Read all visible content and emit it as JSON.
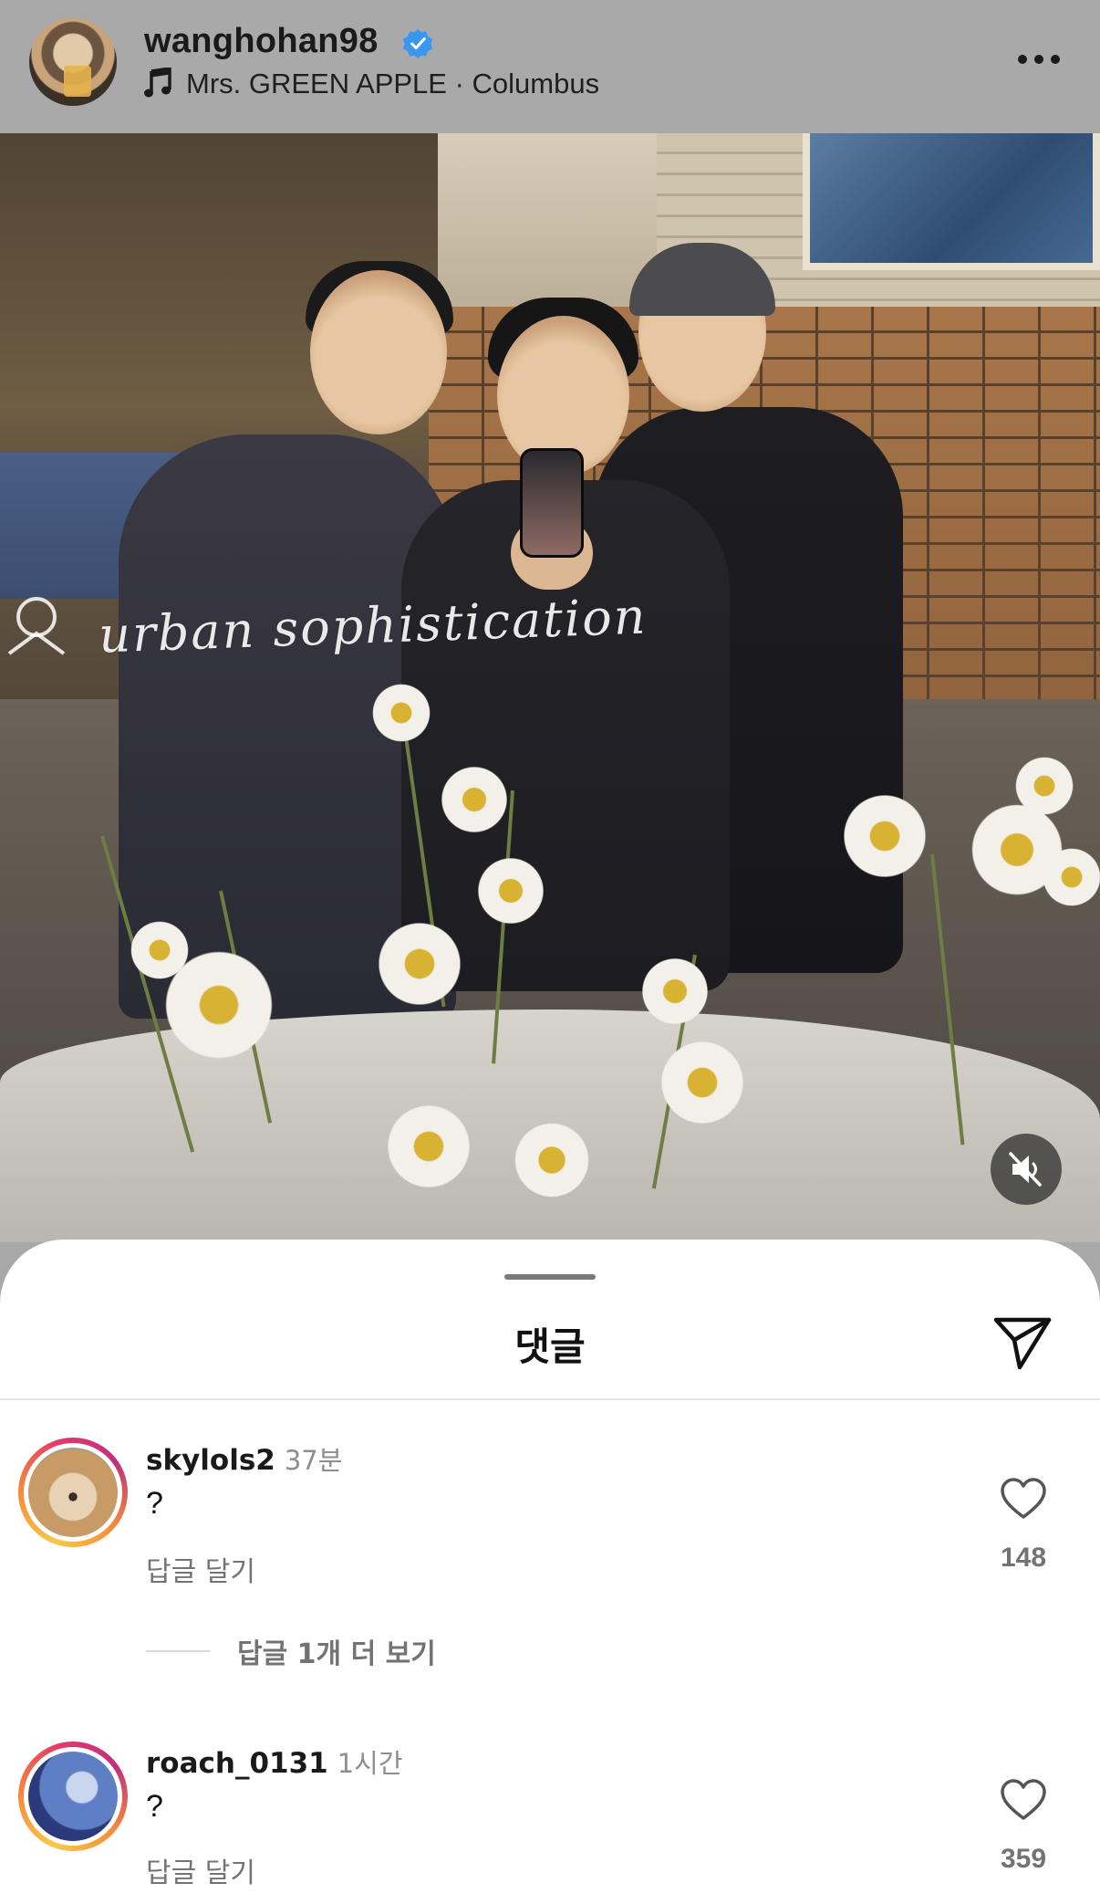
{
  "header": {
    "username": "wanghohan98",
    "verified_icon": "verified-badge-icon",
    "music": "Mrs. GREEN APPLE · Columbus",
    "more_icon": "more-horizontal-icon"
  },
  "video": {
    "watermark": "urban sophistication",
    "mute_icon": "speaker-muted-icon"
  },
  "comments_sheet": {
    "title": "댓글",
    "share_icon": "send-icon",
    "comments": [
      {
        "username": "skylols2",
        "time": "37분",
        "text": "?",
        "reply_label": "답글 달기",
        "likes": "148",
        "view_more": "답글 1개 더 보기"
      },
      {
        "username": "roach_0131",
        "time": "1시간",
        "text": "?",
        "reply_label": "답글 달기",
        "likes": "359"
      }
    ]
  },
  "colors": {
    "header_bg": "#a9a9a9",
    "verified_blue": "#3897f0",
    "sheet_bg": "#ffffff",
    "muted_text": "#737373"
  }
}
